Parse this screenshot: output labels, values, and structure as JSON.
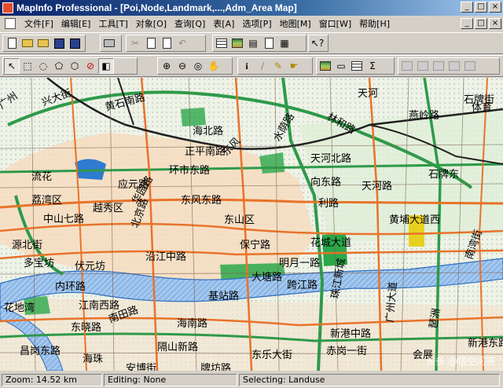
{
  "window": {
    "title": "MapInfo Professional - [Poi,Node,Landmark,...,Adm_Area Map]",
    "buttons": {
      "minimize": "_",
      "maximize": "□",
      "close": "×"
    }
  },
  "menu": [
    {
      "label": "文件[F]"
    },
    {
      "label": "编辑[E]"
    },
    {
      "label": "工具[T]"
    },
    {
      "label": "对象[O]"
    },
    {
      "label": "查询[Q]"
    },
    {
      "label": "表[A]"
    },
    {
      "label": "选项[P]"
    },
    {
      "label": "地图[M]"
    },
    {
      "label": "窗口[W]"
    },
    {
      "label": "帮助[H]"
    }
  ],
  "toolbar_main": [
    "new-document",
    "open",
    "open-workspace",
    "save",
    "print",
    "cut",
    "copy",
    "paste",
    "undo",
    "new-browser",
    "new-map",
    "new-graph",
    "new-layout",
    "new-redistrict",
    "help-pointer"
  ],
  "toolbar_tools": [
    "select",
    "marquee-select",
    "radius-select",
    "polygon-select",
    "boundary-select",
    "unselect-all",
    "invert-selection",
    "zoom-in",
    "zoom-out",
    "change-view",
    "grabber",
    "info",
    "ruler",
    "label",
    "drag-window",
    "layer-control",
    "legend",
    "statistics",
    "disabled-1",
    "disabled-2",
    "disabled-3",
    "disabled-4",
    "disabled-5"
  ],
  "map": {
    "labels": [
      {
        "text": "广州"
      },
      {
        "text": "兴大街"
      },
      {
        "text": "黄石南路"
      },
      {
        "text": "海北路"
      },
      {
        "text": "水荫路"
      },
      {
        "text": "林和路"
      },
      {
        "text": "燕岭路"
      },
      {
        "text": "天河北路"
      },
      {
        "text": "天河"
      },
      {
        "text": "体育"
      },
      {
        "text": "正平南路"
      },
      {
        "text": "东风"
      },
      {
        "text": "环市东路"
      },
      {
        "text": "应元路"
      },
      {
        "text": "越秀区"
      },
      {
        "text": "荔湾区"
      },
      {
        "text": "中山七路"
      },
      {
        "text": "东风东路"
      },
      {
        "text": "东山区"
      },
      {
        "text": "华园路"
      },
      {
        "text": "利路"
      },
      {
        "text": "黄埔大道西"
      },
      {
        "text": "石牌街"
      },
      {
        "text": "源北街"
      },
      {
        "text": "北京路"
      },
      {
        "text": "沿江中路"
      },
      {
        "text": "保宁路"
      },
      {
        "text": "花城大道"
      },
      {
        "text": "多宝坊"
      },
      {
        "text": "伏元坊"
      },
      {
        "text": "明月一路"
      },
      {
        "text": "内环路"
      },
      {
        "text": "大塘路"
      },
      {
        "text": "跨江路"
      },
      {
        "text": "花地湾"
      },
      {
        "text": "江南西路"
      },
      {
        "text": "基站路"
      },
      {
        "text": "新港中路"
      },
      {
        "text": "广州大道"
      },
      {
        "text": "琶洲"
      },
      {
        "text": "海南路"
      },
      {
        "text": "赤岗一街"
      },
      {
        "text": "东晓路"
      },
      {
        "text": "昌岗东路"
      },
      {
        "text": "东乐大街"
      },
      {
        "text": "南田路"
      },
      {
        "text": "隔山新路"
      },
      {
        "text": "会展"
      },
      {
        "text": "新港东路"
      },
      {
        "text": "牌坊路"
      },
      {
        "text": "海珠"
      },
      {
        "text": "安博街"
      },
      {
        "text": "珠江新城"
      },
      {
        "text": "流花"
      },
      {
        "text": "南湾街"
      },
      {
        "text": "向东路"
      },
      {
        "text": "石牌东"
      },
      {
        "text": "天河路"
      }
    ]
  },
  "status": {
    "zoom": "Zoom: 14.52 km",
    "editing": "Editing: None",
    "selecting": "Selecting: Landuse"
  },
  "watermark": "头条 @悟空问答",
  "colors": {
    "title_start": "#0a246a",
    "title_end": "#a6caf0",
    "river": "#4a8bd6",
    "major_road": "#e8732a",
    "ring_road": "#2e9a4a",
    "railway": "#202020",
    "park": "#2aa84a",
    "urban": "#f4d8b8"
  }
}
